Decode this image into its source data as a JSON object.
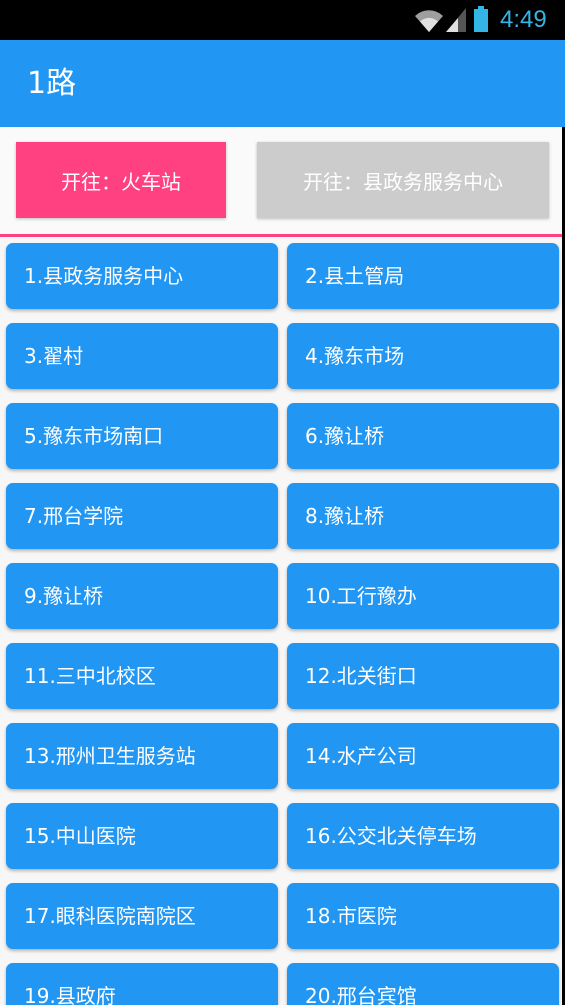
{
  "status_bar": {
    "time": "4:49",
    "icons": [
      "wifi-icon",
      "signal-icon",
      "battery-icon"
    ],
    "color": "#33b5e5"
  },
  "app_bar": {
    "title": "1路",
    "color": "#2196f3"
  },
  "directions": {
    "active_label": "开往：火车站",
    "inactive_label": "开往：县政务服务中心",
    "active_color": "#ff4081",
    "inactive_color": "#cccccc"
  },
  "stations": [
    "1.县政务服务中心",
    "2.县土管局",
    "3.翟村",
    "4.豫东市场",
    "5.豫东市场南口",
    "6.豫让桥",
    "7.邢台学院",
    "8.豫让桥",
    "9.豫让桥",
    "10.工行豫办",
    "11.三中北校区",
    "12.北关街口",
    "13.邢州卫生服务站",
    "14.水产公司",
    "15.中山医院",
    "16.公交北关停车场",
    "17.眼科医院南院区",
    "18.市医院",
    "19.县政府",
    "20.邢台宾馆"
  ]
}
